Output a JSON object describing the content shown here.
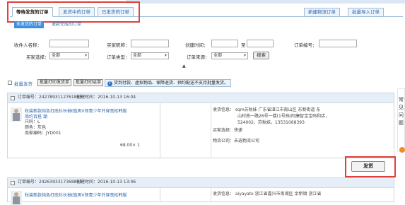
{
  "tabs": {
    "items": [
      {
        "label": "等待发货的订单"
      },
      {
        "label": "发货中的订单"
      },
      {
        "label": "已发货的订单"
      }
    ],
    "right_buttons": [
      {
        "label": "新建物流订单"
      },
      {
        "label": "批量导入订单"
      }
    ]
  },
  "sub_tabs": {
    "active": "未发货的订单",
    "other": "退款完成的订单"
  },
  "filters": {
    "recipient_label": "收件人名称：",
    "buyer_nick_label": "买家昵称：",
    "created_label": "创建时间：",
    "to_label": "至",
    "order_no_label": "订单编号：",
    "buyer_select_label": "买家选择：",
    "buyer_select_value": "全部",
    "order_type_label": "订单类型：",
    "order_type_value": "全部",
    "order_source_label": "订单来源：",
    "order_source_value": "全部",
    "search_label": "搜索"
  },
  "batch": {
    "batch_ship_label": "批量发货",
    "print_ship_label": "批量打印发货单",
    "print_express_label": "批量打印运单",
    "notice": "货到付款、虚拟物品、保障退货、预约配送不支持批量发货。"
  },
  "orders": [
    {
      "order_no_label": "订单编号：",
      "order_no": "2427893112761885",
      "created_label": "创建时间：",
      "created": "2016-10-13 16:04",
      "product_title_1": "秋装新款纯色打底衫长袖t恤男V领青少年外穿宽松韩版",
      "product_title_2": "简约百搭 潮",
      "size": "尺码：L",
      "color": "颜色：灰色",
      "merchant_code": "商家编码：JYD001",
      "price": "68.00× 1",
      "address_1": "收货信息： sqm苏秋妹   广东省湛江市南山区 东新街道 东",
      "address_2": "山村南一路26号一楼(1号档)阿康智宝宝码和店，",
      "address_3": "524002，苏秋妹，13531068393",
      "buyer_choice": "买家选择：快递",
      "logistics": "物流公司：未选物流公司",
      "ship_label": "发货"
    },
    {
      "order_no_label": "订单编号：",
      "order_no": "2426393317368894",
      "created_label": "创建时间：",
      "created": "2016-10-13 13:06",
      "product_title_1": "秋装新款纯色打底衫长袖t恤男V领青少年外穿宽松韩版",
      "address_1": "收货信息：  aiyayato   浙江省嘉兴市南湖区 余新镇 浙江省"
    }
  ],
  "side_widget": {
    "line1": "常",
    "line2": "见",
    "line3": "问",
    "line4": "题"
  },
  "colors": {
    "highlight": "#e0403a",
    "link": "#2a64a8",
    "tab_bg": "#eef4fb",
    "header_bg": "#e6eef8",
    "active_blue": "#3d8fe0"
  }
}
